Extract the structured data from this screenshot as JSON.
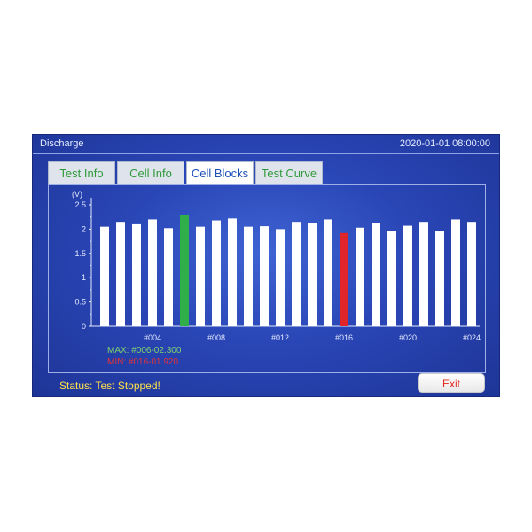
{
  "window": {
    "title": "Discharge",
    "datetime": "2020-01-01 08:00:00"
  },
  "tabs": [
    {
      "label": "Test Info",
      "active": false
    },
    {
      "label": "Cell Info",
      "active": false
    },
    {
      "label": "Cell Blocks",
      "active": true
    },
    {
      "label": "Test Curve",
      "active": false
    }
  ],
  "colors": {
    "background": "#2a46b6",
    "bar": "#ffffff",
    "max_bar": "#2fae4a",
    "min_bar": "#e0262a",
    "status_text": "#ffe14a",
    "exit_text": "#e2261c"
  },
  "chart_data": {
    "type": "bar",
    "ylabel": "(V)",
    "ylim": [
      0,
      2.5
    ],
    "yticks": [
      "0",
      "0.5",
      "1",
      "1.5",
      "2",
      "2.5"
    ],
    "categories": [
      "#001",
      "#002",
      "#003",
      "#004",
      "#005",
      "#006",
      "#007",
      "#008",
      "#009",
      "#010",
      "#011",
      "#012",
      "#013",
      "#014",
      "#015",
      "#016",
      "#017",
      "#018",
      "#019",
      "#020",
      "#021",
      "#022",
      "#023",
      "#024"
    ],
    "xtick_labels": [
      "#004",
      "#008",
      "#012",
      "#016",
      "#020",
      "#024"
    ],
    "values": [
      2.05,
      2.15,
      2.1,
      2.2,
      2.02,
      2.3,
      2.05,
      2.18,
      2.22,
      2.05,
      2.06,
      2.0,
      2.15,
      2.12,
      2.2,
      1.92,
      2.03,
      2.12,
      1.97,
      2.07,
      2.15,
      1.97,
      2.2,
      2.15
    ],
    "max_index": 5,
    "min_index": 15,
    "max_label": "MAX: #006-02.300",
    "min_label": "MIN: #016-01.920",
    "grid": false
  },
  "status": {
    "text": "Status: Test Stopped!"
  },
  "buttons": {
    "exit_label": "Exit"
  }
}
